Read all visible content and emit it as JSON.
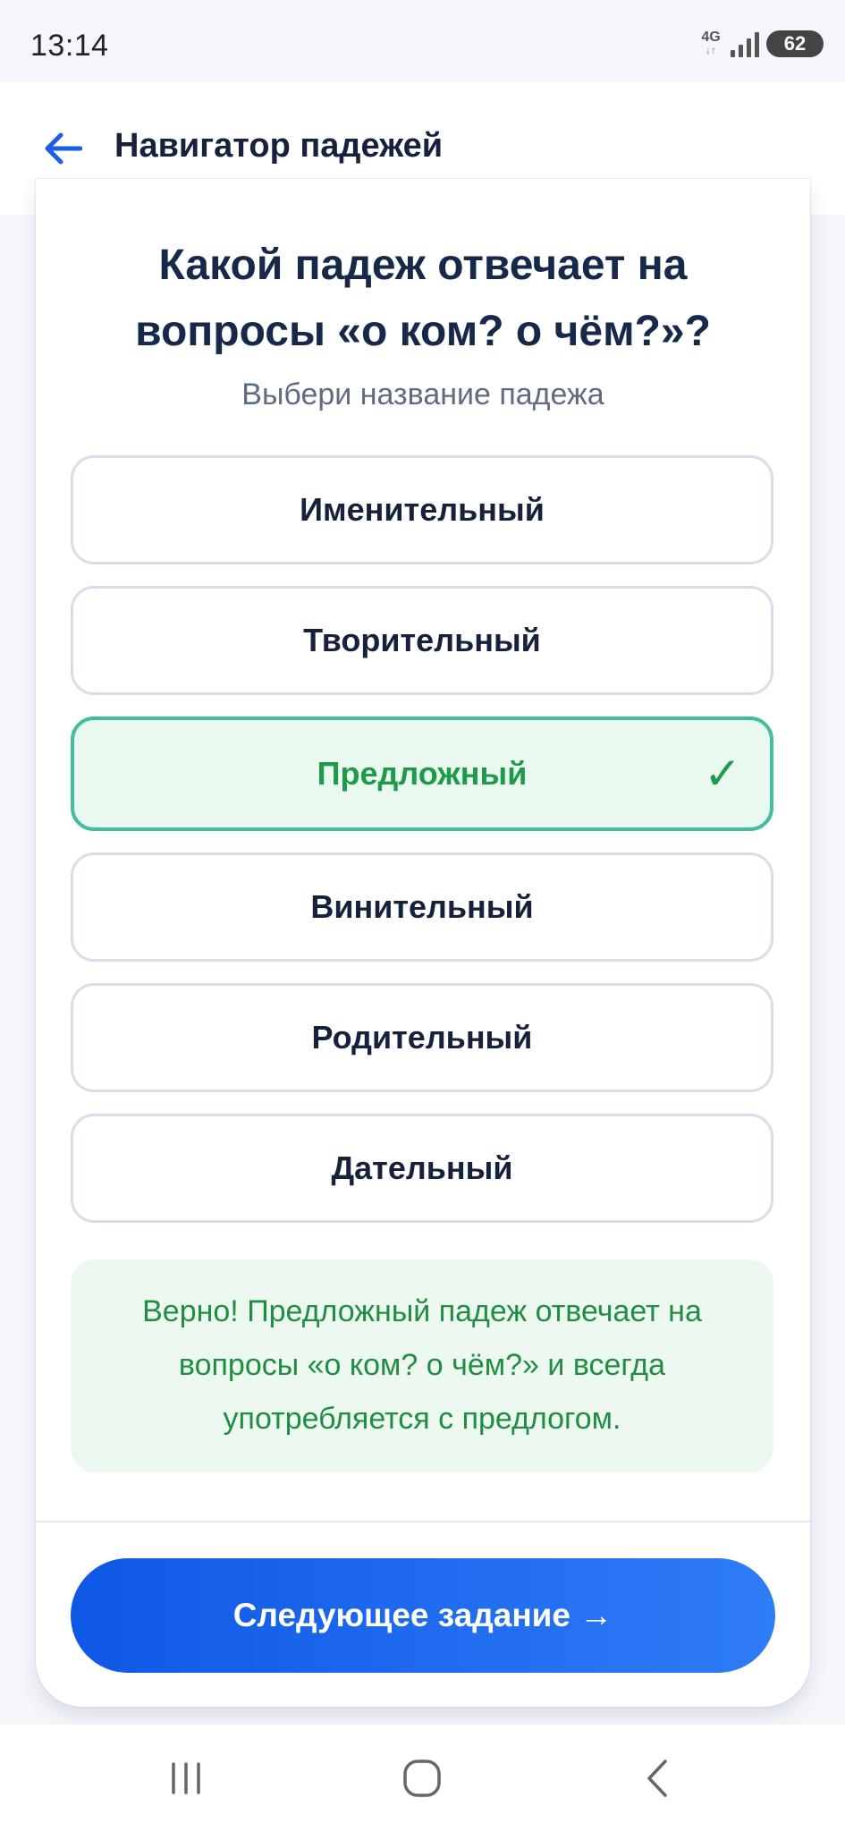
{
  "status_bar": {
    "time": "13:14",
    "network": "4G",
    "network_arrows": "↓↑",
    "battery": "62"
  },
  "header": {
    "title": "Навигатор падежей",
    "back_icon": "arrow-left-icon"
  },
  "question": {
    "line1": "Какой падеж отвечает на",
    "line2": "вопросы «о ком? о чём?»?",
    "hint": "Выбери название падежа"
  },
  "options": [
    {
      "label": "Именительный",
      "state": "default"
    },
    {
      "label": "Творительный",
      "state": "default"
    },
    {
      "label": "Предложный",
      "state": "correct",
      "mark": "✓"
    },
    {
      "label": "Винительный",
      "state": "default"
    },
    {
      "label": "Родительный",
      "state": "default"
    },
    {
      "label": "Дательный",
      "state": "default"
    }
  ],
  "feedback": {
    "text": "Верно! Предложный падеж отвечает на вопросы «о ком? о чём?» и всегда употребляется с предлогом."
  },
  "next_button": {
    "label": "Следующее задание →"
  },
  "nav_bar": {
    "items": [
      "recent-apps-icon",
      "home-icon",
      "back-icon"
    ]
  },
  "colors": {
    "accent": "#1a5fe8",
    "correct_text": "#1f9a48",
    "correct_bg": "#eaf9ef",
    "correct_border": "#3fbf9b",
    "title": "#16213e"
  }
}
